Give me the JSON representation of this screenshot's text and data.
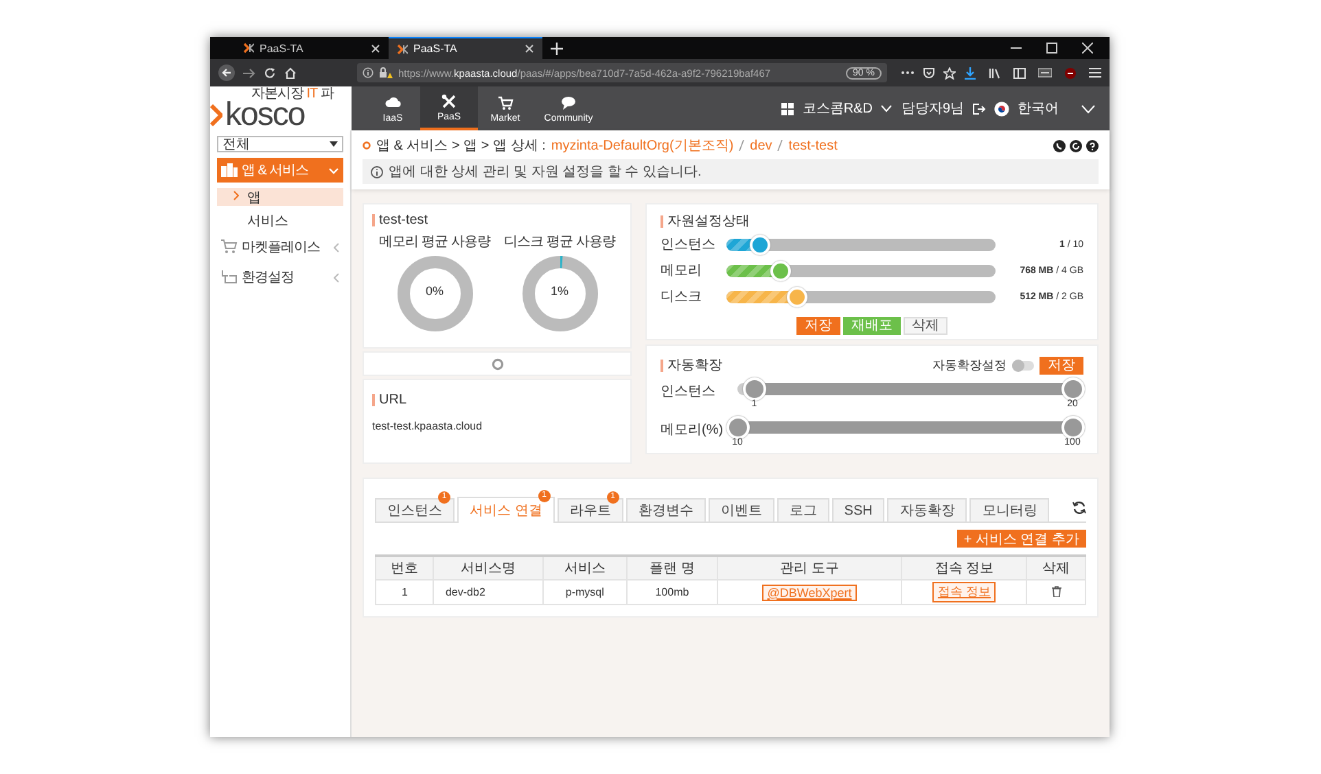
{
  "browser": {
    "tabs": [
      {
        "title": "PaaS-TA",
        "selected": false
      },
      {
        "title": "PaaS-TA",
        "selected": true
      }
    ],
    "url": "https://www.**kpaasta.cloud**/paas/#/apps/bea710d7-7a5d-462a-a9f2-796219baf467",
    "zoom": "90 %"
  },
  "logo": {
    "tagline": [
      {
        "text": "자본시장",
        "accent": false
      },
      {
        "text": "IT",
        "accent": true
      },
      {
        "text": "파",
        "accent": false
      }
    ],
    "wordmark": "kosco"
  },
  "top_nav": {
    "items": [
      {
        "label": "IaaS",
        "selected": false
      },
      {
        "label": "PaaS",
        "selected": true
      },
      {
        "label": "Market",
        "selected": false
      },
      {
        "label": "Community",
        "selected": false
      }
    ],
    "org": "코스콤R&D",
    "user": "담당자9님",
    "language": "한국어"
  },
  "sidebar": {
    "filter": {
      "value": "전체"
    },
    "items": [
      {
        "label": "앱 & 서비스",
        "expanded": true,
        "children": [
          {
            "label": "앱",
            "selected": true
          },
          {
            "label": "서비스",
            "selected": false
          }
        ]
      },
      {
        "label": "마켓플레이스",
        "expanded": false
      },
      {
        "label": "환경설정",
        "expanded": false
      }
    ]
  },
  "breadcrumb": {
    "path": "앱 & 서비스 > 앱 > 앱 상세 :",
    "links": [
      "myzinta-DefaultOrg(기본조직)",
      "dev",
      "test-test"
    ]
  },
  "info": "앱에 대한 상세 관리 및 자원 설정을 할 수 있습니다.",
  "app_card": {
    "title": "test-test",
    "gauges": [
      {
        "label": "메모리 평균 사용량",
        "reading": "0%"
      },
      {
        "label": "디스크 평균 사용량",
        "reading": "1%"
      }
    ],
    "url_title": "URL",
    "url": "test-test.kpaasta.cloud"
  },
  "resources": {
    "title": "자원설정상태",
    "sliders": [
      {
        "label": "인스턴스",
        "level": 0.12,
        "color": "#1ea6d6",
        "reading": "**1** / 10"
      },
      {
        "label": "메모리",
        "level": 0.2,
        "color": "#6cc04a",
        "reading": "**768 MB** / 4 GB"
      },
      {
        "label": "디스크",
        "level": 0.26,
        "color": "#f7b54a",
        "reading": "**512 MB** / 2 GB"
      }
    ],
    "buttons": [
      {
        "label": "저장",
        "kind": "primary"
      },
      {
        "label": "재배포",
        "kind": "success"
      },
      {
        "label": "삭제",
        "kind": "plain"
      }
    ]
  },
  "autoscale": {
    "title": "자동확장",
    "toggle": {
      "label": "자동확장설정",
      "on": false
    },
    "save": "저장",
    "ranges": [
      {
        "label": "인스턴스",
        "low": {
          "level": 0.05,
          "value": "1"
        },
        "high": {
          "level": 1,
          "value": "20"
        }
      },
      {
        "label": "메모리(%)",
        "low": {
          "level": 0,
          "value": "10"
        },
        "high": {
          "level": 1,
          "value": "100"
        }
      }
    ]
  },
  "detail_tabs": [
    {
      "label": "인스턴스",
      "badge": "1",
      "selected": false
    },
    {
      "label": "서비스 연결",
      "badge": "1",
      "selected": true
    },
    {
      "label": "라우트",
      "badge": "1",
      "selected": false
    },
    {
      "label": "환경변수",
      "selected": false
    },
    {
      "label": "이벤트",
      "selected": false
    },
    {
      "label": "로그",
      "selected": false
    },
    {
      "label": "SSH",
      "selected": false
    },
    {
      "label": "자동확장",
      "selected": false
    },
    {
      "label": "모니터링",
      "selected": false
    }
  ],
  "add_button": "+ 서비스 연결 추가",
  "table": {
    "columns": [
      "번호",
      "서비스명",
      "서비스",
      "플랜 명",
      "관리 도구",
      "접속 정보",
      "삭제"
    ],
    "rows": [
      {
        "cells": [
          {
            "kind": "text",
            "text": "1"
          },
          {
            "kind": "text",
            "text": "dev-db2"
          },
          {
            "kind": "text",
            "text": "p-mysql"
          },
          {
            "kind": "text",
            "text": "100mb"
          },
          {
            "kind": "link",
            "text": "@DBWebXpert"
          },
          {
            "kind": "link",
            "text": "접속 정보"
          },
          {
            "kind": "delete"
          }
        ]
      }
    ]
  }
}
